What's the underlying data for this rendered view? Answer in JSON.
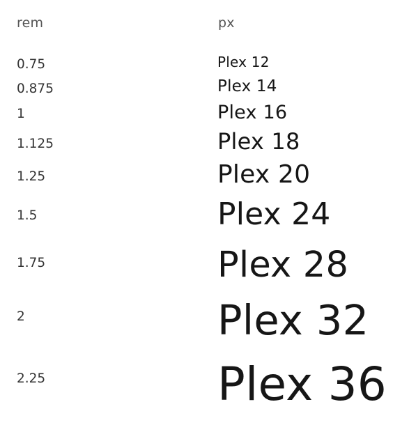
{
  "headers": {
    "rem": "rem",
    "px": "px"
  },
  "rows": [
    {
      "rem": "0.75",
      "sample": "Plex 12"
    },
    {
      "rem": "0.875",
      "sample": "Plex 14"
    },
    {
      "rem": "1",
      "sample": "Plex 16"
    },
    {
      "rem": "1.125",
      "sample": "Plex 18"
    },
    {
      "rem": "1.25",
      "sample": "Plex 20"
    },
    {
      "rem": "1.5",
      "sample": "Plex 24"
    },
    {
      "rem": "1.75",
      "sample": "Plex 28"
    },
    {
      "rem": "2",
      "sample": "Plex 32"
    },
    {
      "rem": "2.25",
      "sample": "Plex 36"
    }
  ],
  "colors": {
    "text": "#161616",
    "header": "#555555",
    "background": "#ffffff"
  }
}
